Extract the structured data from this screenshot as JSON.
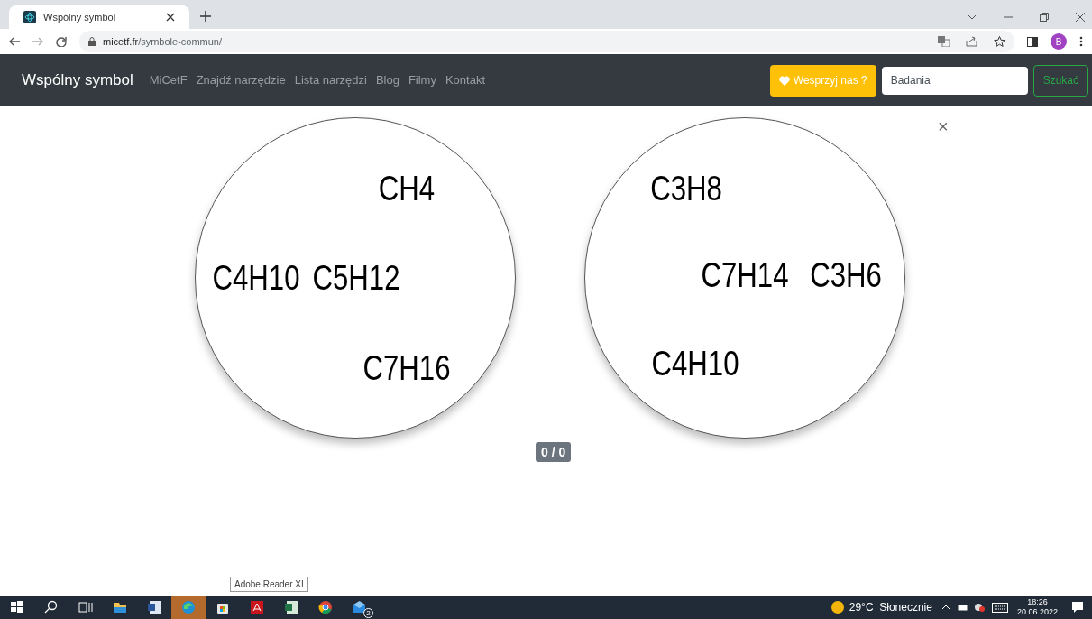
{
  "browser": {
    "tab_title": "Wspólny symbol",
    "url_host": "micetf.fr",
    "url_path": "/symbole-commun/",
    "profile_initial": "B"
  },
  "navbar": {
    "brand": "Wspólny symbol",
    "links": [
      "MiCetF",
      "Znajdź narzędzie",
      "Lista narzędzi",
      "Blog",
      "Filmy",
      "Kontakt"
    ],
    "donate_button": "Wesprzyj nas ?",
    "search_value": "Badania",
    "search_button": "Szukać"
  },
  "close": "×",
  "cards": [
    {
      "symbols": [
        "CH4",
        "C4H10",
        "C5H12",
        "C7H16"
      ]
    },
    {
      "symbols": [
        "C3H8",
        "C7H14",
        "C3H6",
        "C4H10"
      ]
    }
  ],
  "score": "0 / 0",
  "taskbar": {
    "tooltip": "Adobe Reader XI",
    "apps": [
      {
        "kind": "explorer",
        "active": false
      },
      {
        "kind": "word",
        "active": false
      },
      {
        "kind": "edge",
        "active": true
      },
      {
        "kind": "store",
        "active": false
      },
      {
        "kind": "acrobat",
        "active": false
      },
      {
        "kind": "excel",
        "active": false
      },
      {
        "kind": "chrome",
        "active": false
      },
      {
        "kind": "mail",
        "active": false,
        "badge": "2"
      }
    ],
    "weather": "29°C  Słonecznie",
    "time": "18:26",
    "date": "20.06.2022"
  }
}
